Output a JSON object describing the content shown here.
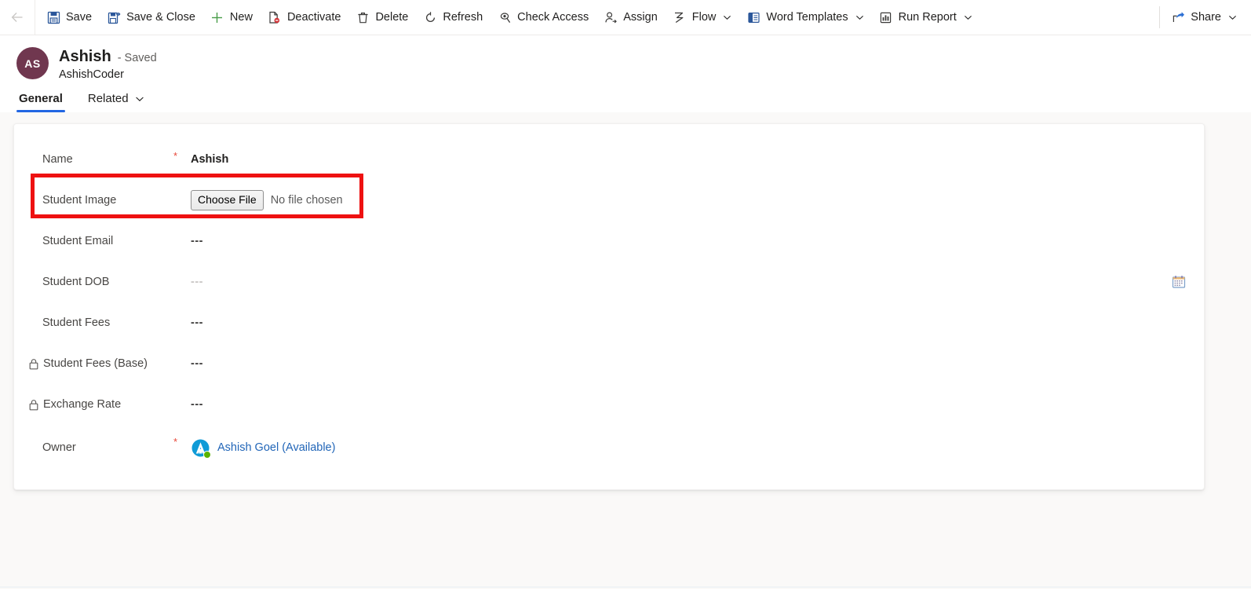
{
  "commandbar": {
    "back_label": "Back",
    "items": [
      {
        "label": "Save",
        "icon": "save-icon",
        "chevron": false
      },
      {
        "label": "Save & Close",
        "icon": "save-and-close-icon",
        "chevron": false
      },
      {
        "label": "New",
        "icon": "plus-icon",
        "chevron": false
      },
      {
        "label": "Deactivate",
        "icon": "deactivate-icon",
        "chevron": false
      },
      {
        "label": "Delete",
        "icon": "trash-icon",
        "chevron": false
      },
      {
        "label": "Refresh",
        "icon": "refresh-icon",
        "chevron": false
      },
      {
        "label": "Check Access",
        "icon": "check-access-icon",
        "chevron": false
      },
      {
        "label": "Assign",
        "icon": "assign-user-icon",
        "chevron": false
      },
      {
        "label": "Flow",
        "icon": "flow-icon",
        "chevron": true
      },
      {
        "label": "Word Templates",
        "icon": "word-templates-icon",
        "chevron": true
      },
      {
        "label": "Run Report",
        "icon": "run-report-icon",
        "chevron": true
      }
    ],
    "share": {
      "label": "Share",
      "icon": "share-icon",
      "chevron": true
    }
  },
  "record": {
    "avatar_initials": "AS",
    "avatar_color": "#70374f",
    "title": "Ashish",
    "saved_state": "- Saved",
    "entity_name": "AshishCoder",
    "tabs": [
      {
        "label": "General",
        "active": true,
        "chevron": false
      },
      {
        "label": "Related",
        "active": false,
        "chevron": true
      }
    ]
  },
  "form": {
    "fields": [
      {
        "label": "Name",
        "required": "*",
        "value": "Ashish",
        "value_style": "strong",
        "locked": false
      },
      {
        "label": "Student Image",
        "required": "",
        "value": "",
        "value_style": "file",
        "locked": false,
        "file": {
          "button_label": "Choose File",
          "status_text": "No file chosen"
        },
        "highlighted": true
      },
      {
        "label": "Student Email",
        "required": "",
        "value": "---",
        "value_style": "dashes",
        "locked": false
      },
      {
        "label": "Student DOB",
        "required": "",
        "value": "---",
        "value_style": "dashes-faint",
        "locked": false,
        "calendar_icon": "calendar-icon"
      },
      {
        "label": "Student Fees",
        "required": "",
        "value": "---",
        "value_style": "dashes",
        "locked": false
      },
      {
        "label": "Student Fees (Base)",
        "required": "",
        "value": "---",
        "value_style": "dashes",
        "locked": true
      },
      {
        "label": "Exchange Rate",
        "required": "",
        "value": "---",
        "value_style": "dashes",
        "locked": true
      },
      {
        "label": "Owner",
        "required": "*",
        "value": "Ashish Goel (Available)",
        "value_style": "owner",
        "locked": false,
        "owner": {
          "name": "Ashish Goel (Available)",
          "avatar_letter": "A",
          "avatar_color": "#0f9bd7",
          "presence_color": "#5ab300",
          "presence": "Available"
        }
      }
    ]
  },
  "annotation": {
    "color": "#ee1111",
    "target": "Student Image"
  }
}
